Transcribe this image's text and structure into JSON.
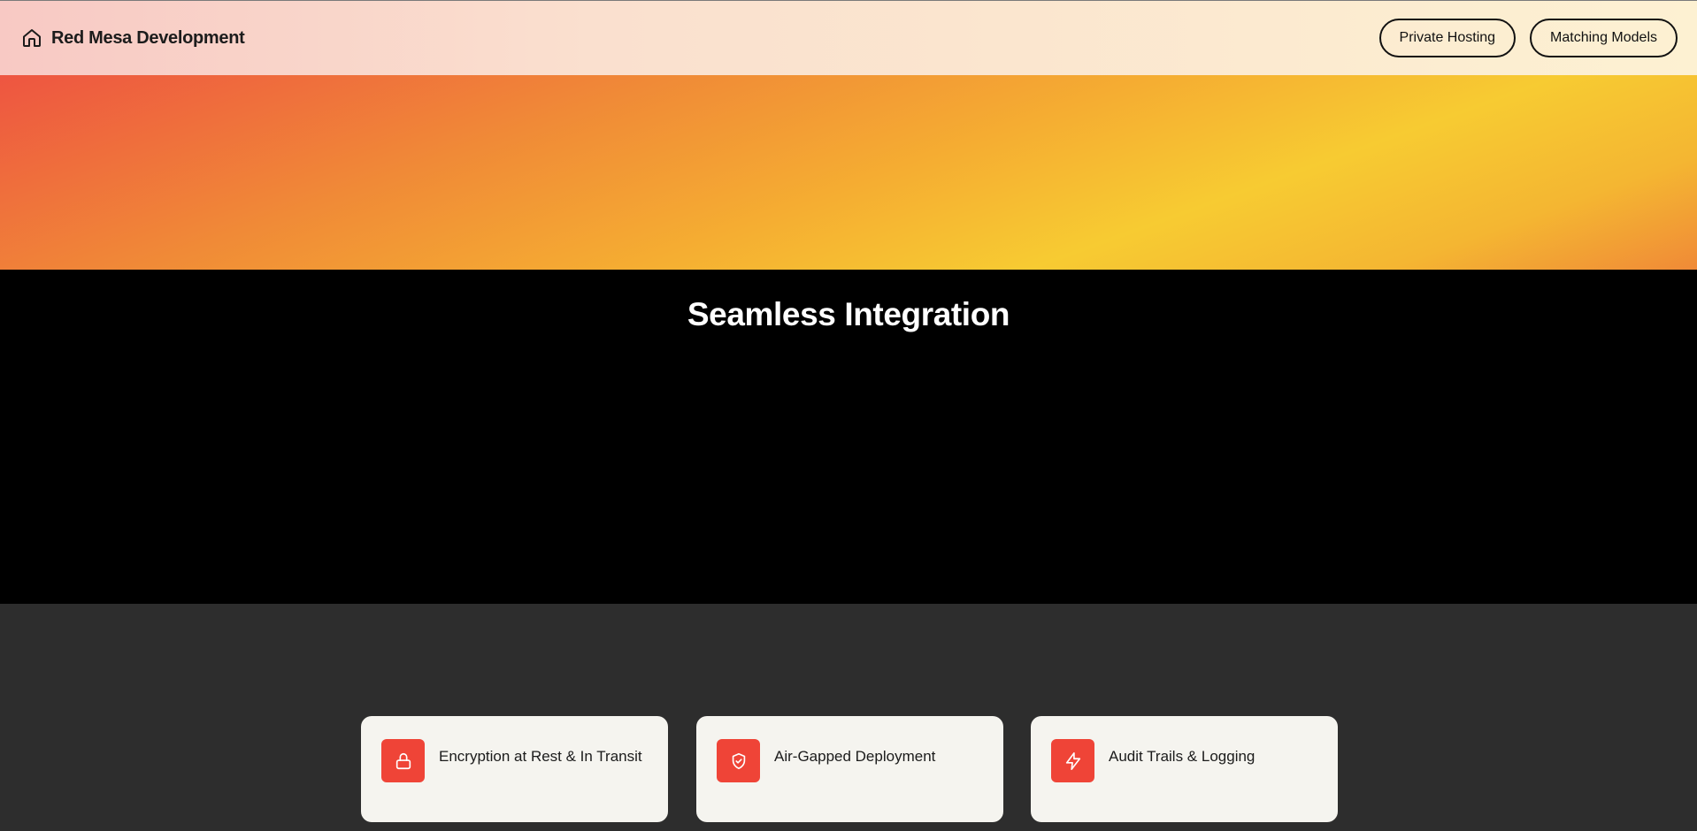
{
  "header": {
    "brand_name": "Red Mesa Development",
    "brand_icon": "home-icon",
    "nav": [
      {
        "label": "Private Hosting"
      },
      {
        "label": "Matching Models"
      }
    ]
  },
  "hero": {
    "gradient_colors": [
      "#ee5541",
      "#f08a37",
      "#f5ad32",
      "#f7cb32"
    ]
  },
  "section": {
    "title": "Seamless Integration"
  },
  "features": [
    {
      "label": "Encryption at Rest & In Transit",
      "icon": "lock-icon"
    },
    {
      "label": "Air-Gapped Deployment",
      "icon": "shield-check-icon"
    },
    {
      "label": "Audit Trails & Logging",
      "icon": "lightning-icon"
    }
  ],
  "colors": {
    "accent": "#ef4437",
    "card_bg": "#f5f4ef",
    "features_bg": "#2d2d2d",
    "dark_bg": "#000000"
  }
}
